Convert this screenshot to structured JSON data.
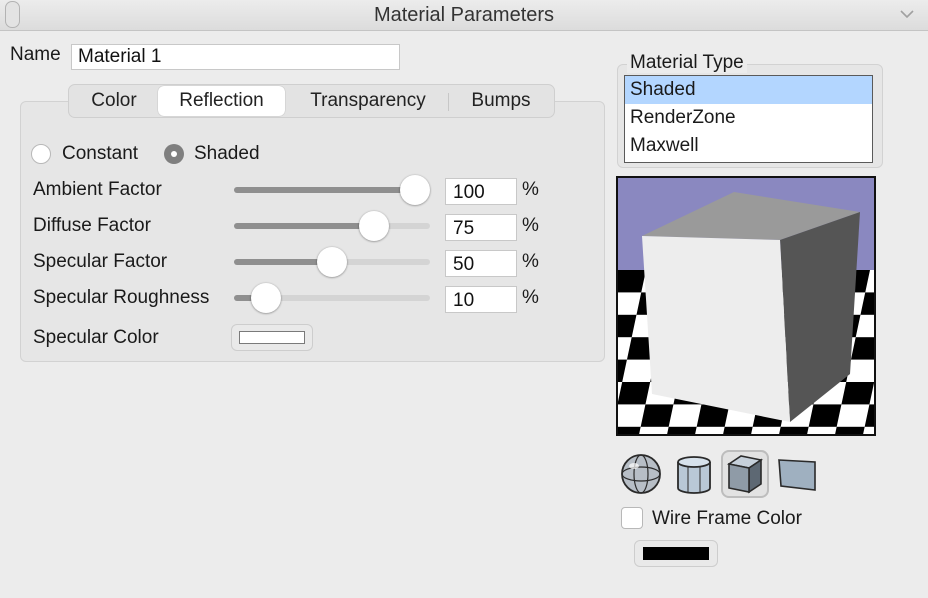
{
  "window": {
    "title": "Material Parameters"
  },
  "name_field": {
    "label": "Name",
    "value": "Material 1"
  },
  "tabs": [
    {
      "label": "Color",
      "active": false
    },
    {
      "label": "Reflection",
      "active": true
    },
    {
      "label": "Transparency",
      "active": false
    },
    {
      "label": "Bumps",
      "active": false
    }
  ],
  "reflection": {
    "mode_options": [
      {
        "label": "Constant",
        "selected": false
      },
      {
        "label": "Shaded",
        "selected": true
      }
    ],
    "sliders": [
      {
        "label": "Ambient Factor",
        "value": "100",
        "unit": "%",
        "fraction": 1.0
      },
      {
        "label": "Diffuse Factor",
        "value": "75",
        "unit": "%",
        "fraction": 0.75
      },
      {
        "label": "Specular Factor",
        "value": "50",
        "unit": "%",
        "fraction": 0.5
      },
      {
        "label": "Specular Roughness",
        "value": "10",
        "unit": "%",
        "fraction": 0.1
      }
    ],
    "specular_color": {
      "label": "Specular Color",
      "color": "#ffffff"
    }
  },
  "material_type": {
    "label": "Material Type",
    "options": [
      {
        "label": "Shaded",
        "selected": true
      },
      {
        "label": "RenderZone",
        "selected": false
      },
      {
        "label": "Maxwell",
        "selected": false
      }
    ]
  },
  "preview": {
    "background_color": "#8a88c0",
    "shapes": [
      {
        "icon": "sphere-icon",
        "selected": false
      },
      {
        "icon": "cylinder-icon",
        "selected": false
      },
      {
        "icon": "cube-icon",
        "selected": true
      },
      {
        "icon": "plane-icon",
        "selected": false
      }
    ]
  },
  "wireframe": {
    "label": "Wire Frame Color",
    "checked": false,
    "color": "#000000"
  },
  "colors": {
    "list_selection": "#b3d6ff",
    "slider_fill": "#8f8f8f"
  }
}
